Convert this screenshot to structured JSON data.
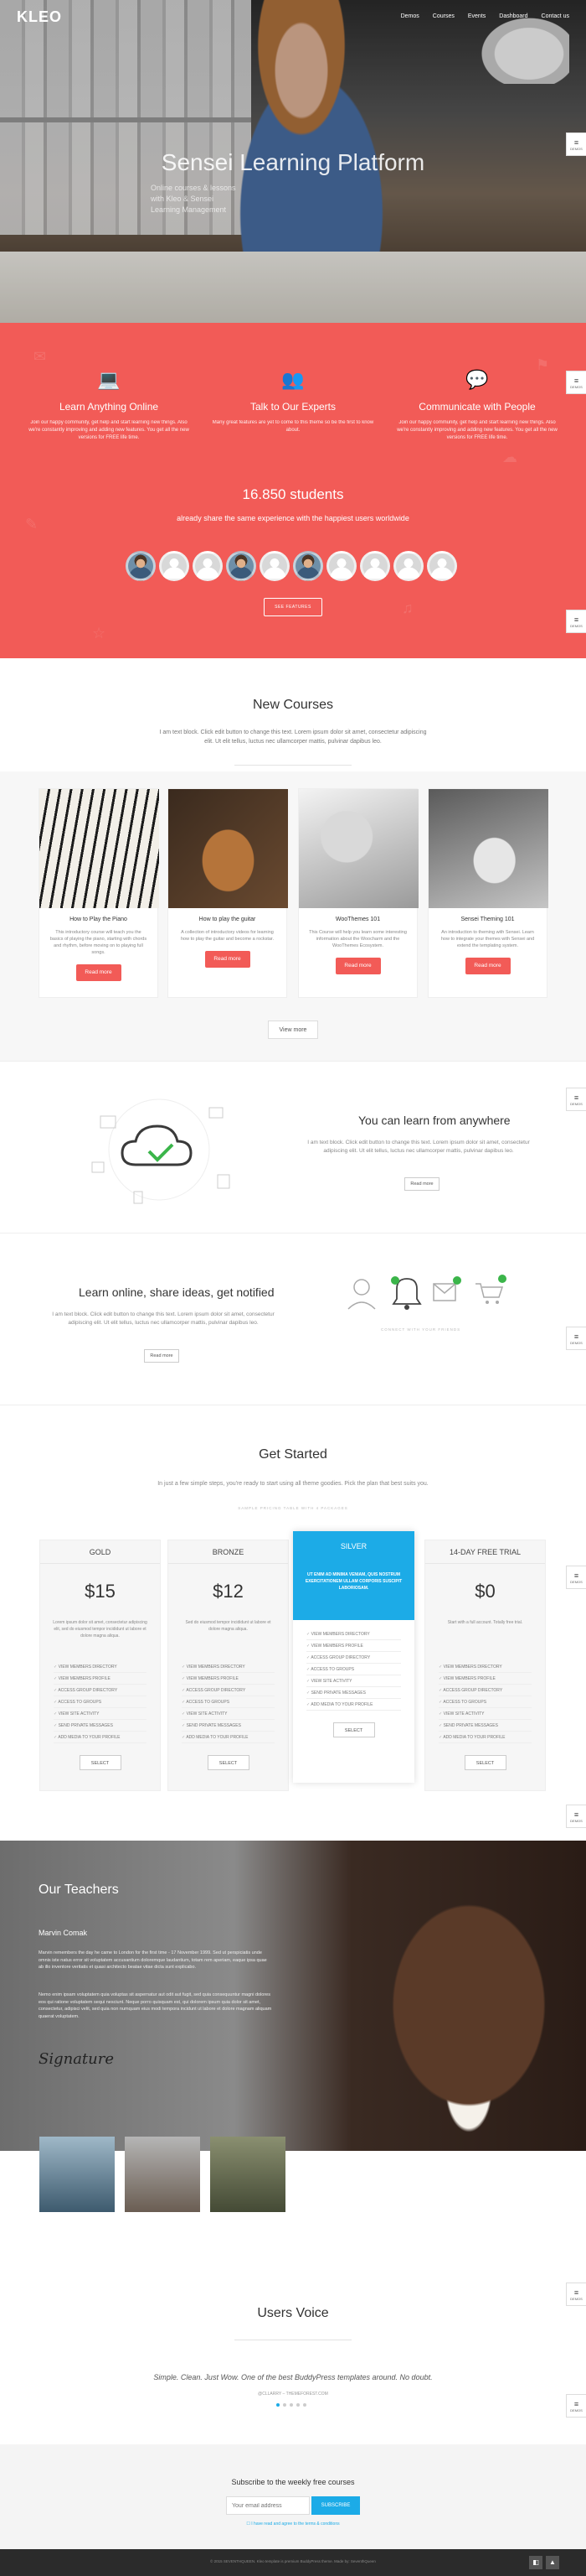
{
  "header": {
    "logo": "KLEO",
    "nav": [
      "Demos",
      "Courses",
      "Events",
      "Dashboard",
      "Contact us"
    ]
  },
  "hero": {
    "title": "Sensei Learning Platform",
    "subtitle_lines": [
      "Online courses & lessons",
      "with Kleo & Sensei",
      "Learning Management"
    ]
  },
  "side_widget": {
    "label": "DEMOS"
  },
  "features": [
    {
      "icon": "laptop-icon",
      "title": "Learn Anything Online",
      "text": "Join our happy community, get help and start learning new things. Also we're constantly improving and adding new features. You get all the new versions for FREE life time."
    },
    {
      "icon": "users-icon",
      "title": "Talk to Our Experts",
      "text": "Many great features are yet to come to this theme so be the first to know about."
    },
    {
      "icon": "chat-icon",
      "title": "Communicate with People",
      "text": "Join our happy community, get help and start learning new things. Also we're constantly improving and adding new features. You get all the new versions for FREE life time."
    }
  ],
  "stats": {
    "count": "16.850 students",
    "subtitle": "already share the same experience with the happiest users worldwide",
    "button": "SEE FEATURES"
  },
  "courses_section": {
    "title": "New Courses",
    "desc": "I am text block. Click edit button to change this text. Lorem ipsum dolor sit amet, consectetur adipiscing elit. Ut elit tellus, luctus nec ullamcorper mattis, pulvinar dapibus leo.",
    "items": [
      {
        "title": "How to Play the Piano",
        "text": "This introductory course will teach you the basics of playing the piano, starting with chords and rhythm, before moving on to playing full songs.",
        "button": "Read more"
      },
      {
        "title": "How to play the guitar",
        "text": "A collection of introductory videos for learning how to play the guitar and become a rockstar.",
        "button": "Read more"
      },
      {
        "title": "WooThemes 101",
        "text": "This Course will help you learn some interesting information about the Woocharm and the WooThemes Ecosystem.",
        "button": "Read more"
      },
      {
        "title": "Sensei Theming 101",
        "text": "An introduction to theming with Sensei. Learn how to integrate your themes with Sensei and extend the templating system.",
        "button": "Read more"
      }
    ],
    "view_more": "View more"
  },
  "anywhere": {
    "title": "You can learn from anywhere",
    "text": "I am text block. Click edit button to change this text. Lorem ipsum dolor sit amet, consectetur adipiscing elit. Ut elit tellus, luctus nec ullamcorper mattis, pulvinar dapibus leo.",
    "button": "Read more"
  },
  "share": {
    "title": "Learn online, share ideas, get notified",
    "text": "I am text block. Click edit button to change this text. Lorem ipsum dolor sit amet, consectetur adipiscing elit. Ut elit tellus, luctus nec ullamcorper mattis, pulvinar dapibus leo.",
    "button": "Read more",
    "caption": "CONNECT WITH YOUR FRIENDS"
  },
  "pricing": {
    "title": "Get Started",
    "desc": "In just a few simple steps, you're ready to start using all theme goodies. Pick the plan that best suits you.",
    "caption": "SAMPLE PRICING TABLE WITH 4 PACKAGES",
    "features": [
      "VIEW MEMBERS DIRECTORY",
      "VIEW MEMBERS PROFILE",
      "ACCESS GROUP DIRECTORY",
      "ACCESS TO GROUPS",
      "VIEW SITE ACTIVITY",
      "SEND PRIVATE MESSAGES",
      "ADD MEDIA TO YOUR PROFILE"
    ],
    "plans": [
      {
        "name": "GOLD",
        "price": "$15",
        "desc": "Lorem ipsum dolor sit amet, consectetur adipiscing elit, sed do eiusmod tempor incididunt ut labore et dolore magna aliqua.",
        "button": "SELECT"
      },
      {
        "name": "BRONZE",
        "price": "$12",
        "desc": "Sed do eiusmod tempor incididunt ut labore et dolore magna aliqua.",
        "button": "SELECT"
      },
      {
        "name": "SILVER",
        "price": "",
        "desc": "UT ENIM AD MINIMA VENIAM, QUIS NOSTRUM EXERCITATIONEM ULLAM CORPORIS SUSCIPIT LABORIOSAM.",
        "button": "SELECT"
      },
      {
        "name": "14-DAY FREE TRIAL",
        "price": "$0",
        "desc": "Start with a full account. Totally free trial.",
        "button": "SELECT"
      }
    ]
  },
  "teachers": {
    "title": "Our Teachers",
    "name": "Marvin Comak",
    "bio1": "Marvin remembers the day he came to London for the first time - 17 November 1999. Sed ut perspiciatis unde omnis iste natus error sit voluptatem accusantium doloremque laudantium, totam rem aperiam, eaque ipsa quae ab illo inventore veritatis et quasi architecto beatae vitae dicta sunt explicabo.",
    "bio2": "Nemo enim ipsam voluptatem quia voluptas sit aspernatur aut odit aut fugit, sed quia consequuntur magni dolores eos qui ratione voluptatem sequi nesciunt. Neque porro quisquam est, qui dolorem ipsum quia dolor sit amet, consectetur, adipisci velit, sed quia non numquam eius modi tempora incidunt ut labore et dolore magnam aliquam quaerat voluptatem.",
    "signature": "Signature"
  },
  "voice": {
    "title": "Users Voice",
    "quote": "Simple. Clean. Just Wow. One of the best BuddyPress templates around. No doubt.",
    "author": "@CLLARRY – THEMEFOREST.COM"
  },
  "subscribe": {
    "title": "Subscribe to the weekly free courses",
    "placeholder": "Your email address",
    "button": "SUBSCRIBE",
    "terms": "I have read and agree to the terms & conditions"
  },
  "footer": {
    "text": "© 2015 SEVENTHQUEEN. Kleo template is premium BuddyPress theme. Made by: SeventhQueen"
  },
  "colors": {
    "accent": "#f25b57",
    "blue": "#1cabe7"
  }
}
